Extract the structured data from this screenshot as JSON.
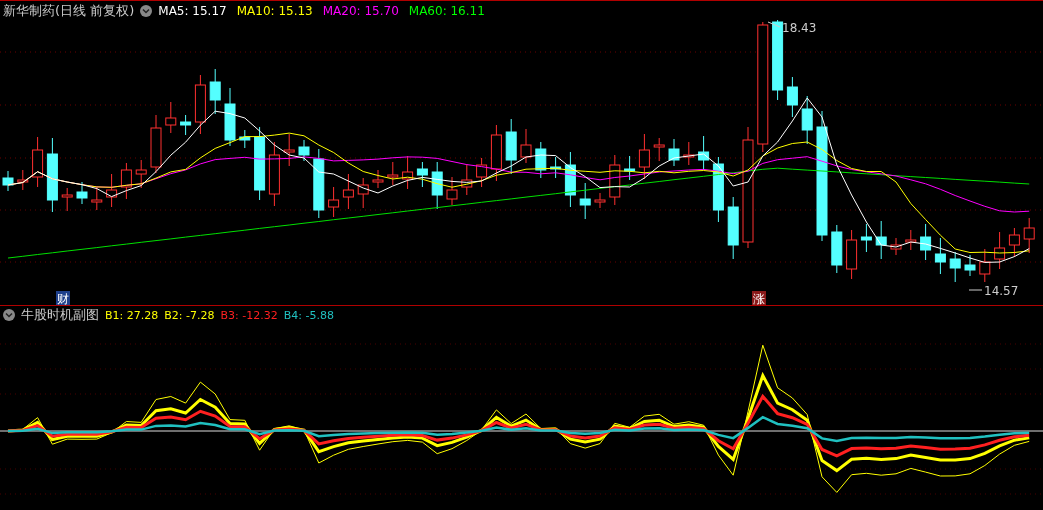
{
  "main_chart": {
    "title": "新华制药(日线 前复权)",
    "ma_legend": [
      {
        "label": "MA5: 15.17",
        "color": "#ffffff"
      },
      {
        "label": "MA10: 15.13",
        "color": "#ffff00"
      },
      {
        "label": "MA20: 15.70",
        "color": "#ff00ff"
      },
      {
        "label": "MA60: 16.11",
        "color": "#00ff00"
      }
    ],
    "high_label": "18.43",
    "low_label": "14.57",
    "event_badges": [
      {
        "text": "财",
        "color": "#1e3f8a"
      },
      {
        "text": "涨",
        "color": "#8a1a1a"
      }
    ]
  },
  "sub_chart": {
    "title": "牛股时机副图",
    "legend": [
      {
        "label": "B1: 27.28",
        "color": "#ffff00"
      },
      {
        "label": "B2: -7.28",
        "color": "#ffff00"
      },
      {
        "label": "B3: -12.32",
        "color": "#ff2020"
      },
      {
        "label": "B4: -5.88",
        "color": "#20c0c0"
      }
    ]
  }
}
